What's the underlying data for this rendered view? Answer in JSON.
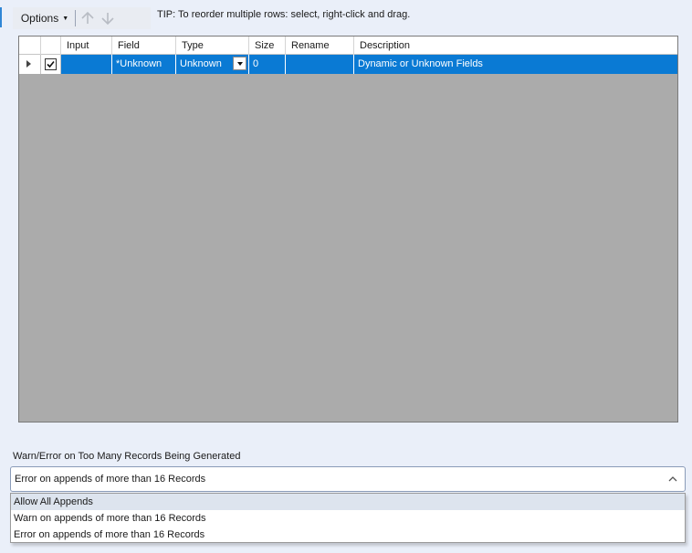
{
  "colors": {
    "background": "#eaeff9",
    "selection": "#0a7ad4",
    "grid_empty": "#ababab",
    "accent": "#2f86d6"
  },
  "toolbar": {
    "options_label": "Options",
    "up_icon": "arrow-up-icon",
    "down_icon": "arrow-down-icon",
    "tip": "TIP: To reorder multiple rows: select, right-click and drag."
  },
  "grid": {
    "columns": [
      "Input",
      "Field",
      "Type",
      "Size",
      "Rename",
      "Description"
    ],
    "rows": [
      {
        "selected": true,
        "input": "",
        "field": "*Unknown",
        "type": "Unknown",
        "size": "0",
        "rename": "",
        "description": "Dynamic or Unknown Fields"
      }
    ]
  },
  "warn": {
    "label": "Warn/Error on Too Many Records Being Generated",
    "selected_value": "Error on appends of more than 16 Records",
    "options": [
      "Allow All Appends",
      "Warn on appends of more than 16 Records",
      "Error on appends of more than 16 Records"
    ],
    "highlighted_index": 0
  }
}
